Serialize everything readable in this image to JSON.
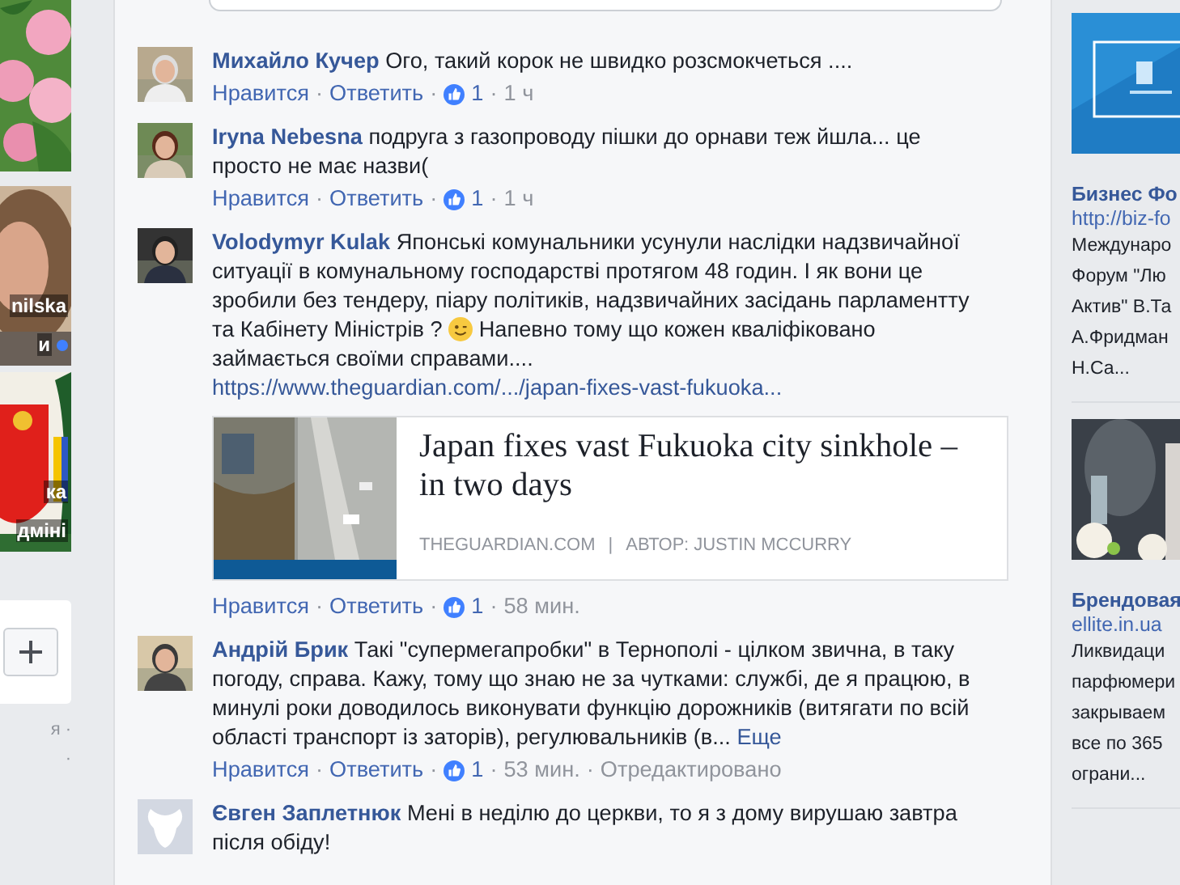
{
  "left_tiles": [
    {
      "kind": "picture"
    },
    {
      "kind": "picture",
      "lines": [
        {
          "text": "nilska"
        },
        {
          "text": "и",
          "online": true
        }
      ]
    },
    {
      "kind": "picture",
      "lines": [
        {
          "text": "ка"
        },
        {
          "text": "дміні"
        }
      ]
    }
  ],
  "left_footer": [
    "я ·",
    "·"
  ],
  "comments": [
    {
      "author": "Михайло Кучер",
      "text": "Ого, такий корок не швидко розсмокчеться ....",
      "meta": [
        {
          "kind": "action",
          "text": "Нравится"
        },
        {
          "kind": "sep",
          "text": "·"
        },
        {
          "kind": "action",
          "text": "Ответить"
        },
        {
          "kind": "sep",
          "text": "·"
        },
        {
          "kind": "like",
          "text": "1"
        },
        {
          "kind": "sep",
          "text": "·"
        },
        {
          "kind": "time",
          "text": "1 ч"
        }
      ]
    },
    {
      "author": "Iryna Nebesna",
      "text": "подруга з газопроводу пішки до орнави теж йшла... це просто не має назви(",
      "meta": [
        {
          "kind": "action",
          "text": "Нравится"
        },
        {
          "kind": "sep",
          "text": "·"
        },
        {
          "kind": "action",
          "text": "Ответить"
        },
        {
          "kind": "sep",
          "text": "·"
        },
        {
          "kind": "like",
          "text": "1"
        },
        {
          "kind": "sep",
          "text": "·"
        },
        {
          "kind": "time",
          "text": "1 ч"
        }
      ]
    },
    {
      "author": "Volodymyr Kulak",
      "text": "Японські комунальники усунули наслідки надзвичайної ситуації в комунальному господарстві протягом 48 годин. І як вони це зробили без тендеру, піару політиків, надзвичайних засідань парламентту та Кабінету Міністрів ?",
      "emoji": true,
      "text2": "Напевно тому що кожен кваліфіковано займається своїми справами....",
      "link": "https://www.theguardian.com/.../japan-fixes-vast-fukuoka...",
      "preview": {
        "title": "Japan fixes vast Fukuoka city sinkhole – in two days",
        "source": "THEGUARDIAN.COM",
        "divider": "|",
        "author": "АВТОР: JUSTIN MCCURRY"
      },
      "meta": [
        {
          "kind": "action",
          "text": "Нравится"
        },
        {
          "kind": "sep",
          "text": "·"
        },
        {
          "kind": "action",
          "text": "Ответить"
        },
        {
          "kind": "sep",
          "text": "·"
        },
        {
          "kind": "like",
          "text": "1"
        },
        {
          "kind": "sep",
          "text": "·"
        },
        {
          "kind": "time",
          "text": "58 мин."
        }
      ]
    },
    {
      "author": "Андрій Брик",
      "text": "Такі \"супермегапробки\" в Тернополі - цілком звична, в таку погоду, справа. Кажу, тому що знаю не за чутками: службі, де я працюю, в минулі роки доводилось виконувати функцію дорожників  (витягати по всій області транспорт із заторів), регулювальників  (в...",
      "more": "Еще",
      "meta": [
        {
          "kind": "action",
          "text": "Нравится"
        },
        {
          "kind": "sep",
          "text": "·"
        },
        {
          "kind": "action",
          "text": "Ответить"
        },
        {
          "kind": "sep",
          "text": "·"
        },
        {
          "kind": "like",
          "text": "1"
        },
        {
          "kind": "sep",
          "text": "·"
        },
        {
          "kind": "time",
          "text": "53 мин."
        },
        {
          "kind": "sep",
          "text": "·"
        },
        {
          "kind": "time",
          "text": "Отредактировано"
        }
      ]
    },
    {
      "author": "Євген Заплетнюк",
      "text": "Мені в неділю до церкви, то я з дому вирушаю завтра після обіду!",
      "default_avatar": true
    }
  ],
  "ads": [
    {
      "title": "Бизнес Фо",
      "url": "http://biz-fo",
      "lines": [
        "Междунаро",
        "Форум \"Лю",
        "Актив\" В.Та",
        "А.Фридман",
        "Н.Са..."
      ]
    },
    {
      "title": "Брендовая",
      "url": "ellite.in.ua",
      "lines": [
        "Ликвидаци",
        "парфюмери",
        "закрываем",
        "все по 365",
        "ограни..."
      ]
    }
  ]
}
